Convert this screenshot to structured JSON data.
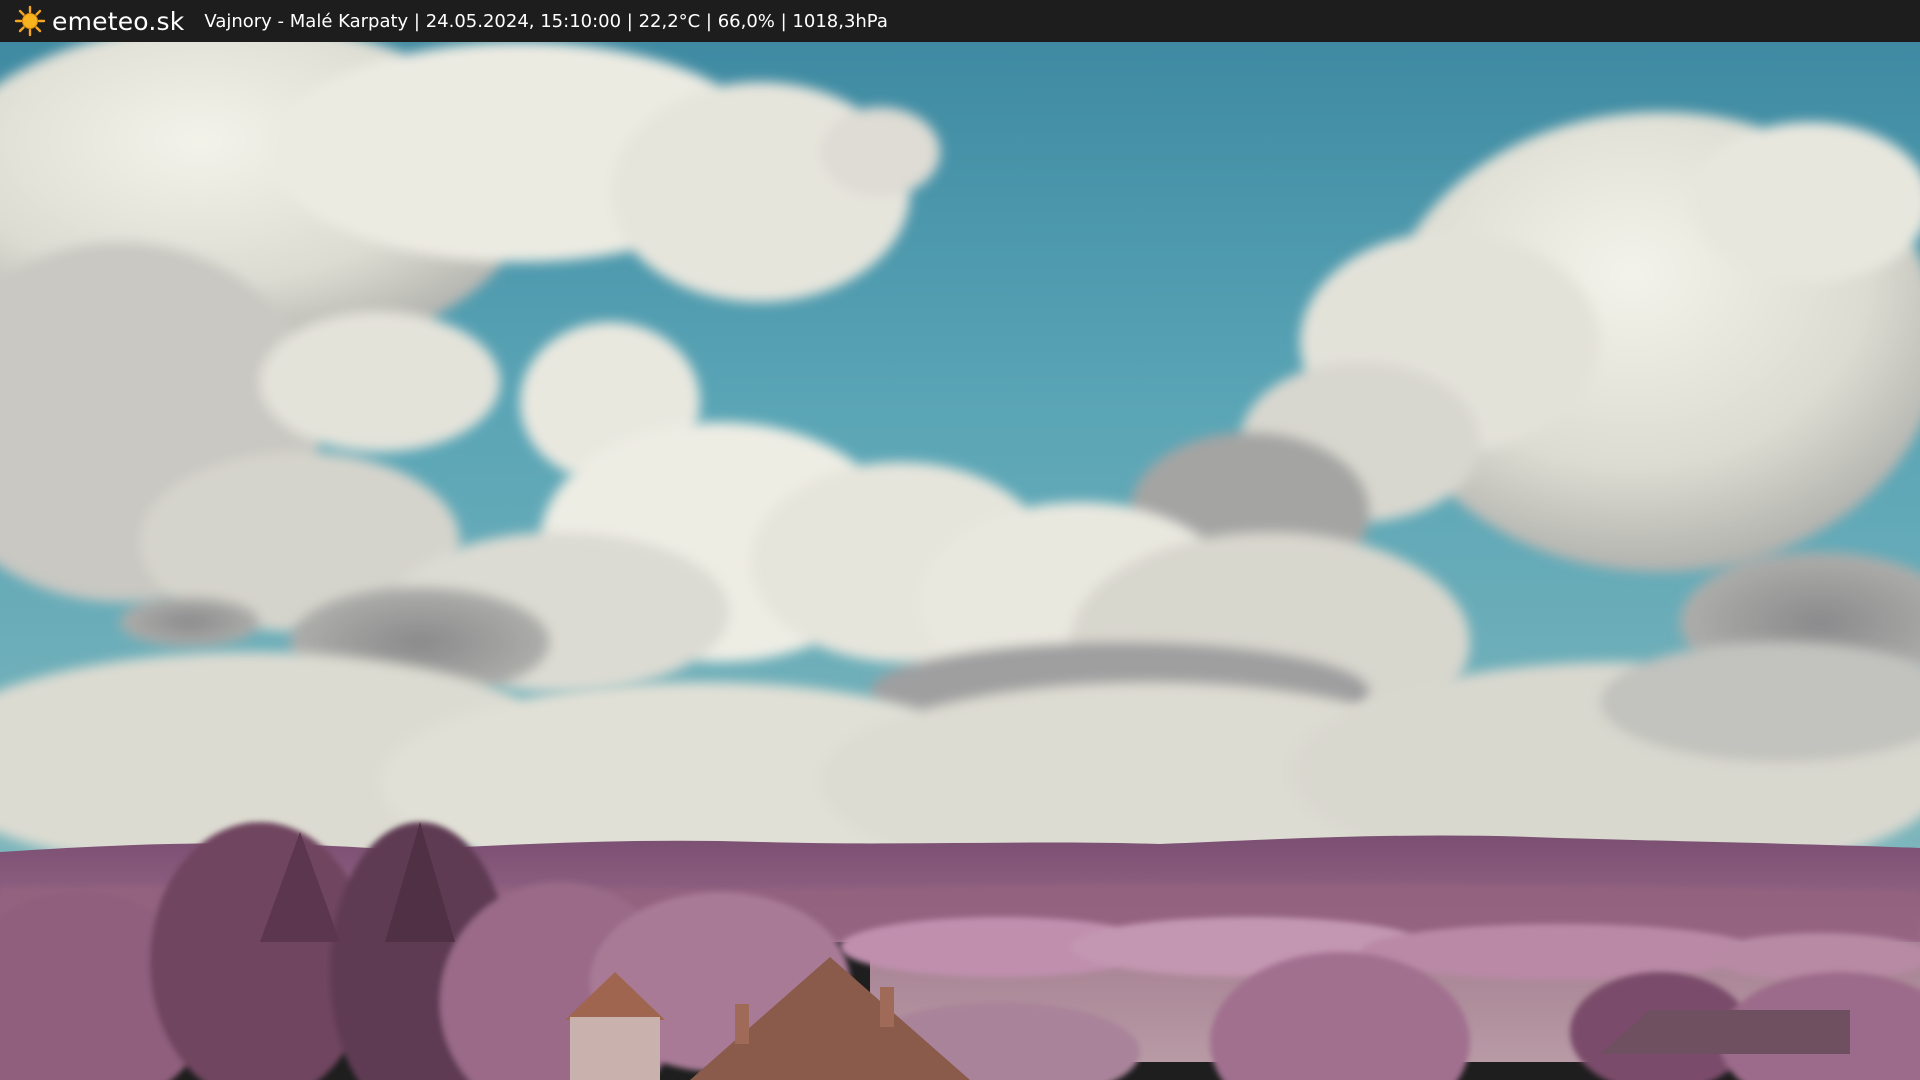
{
  "header": {
    "logo_text": "emeteo.sk",
    "caption": "Vajnory - Malé Karpaty | 24.05.2024, 15:10:00 | 22,2°C | 66,0% | 1018,3hPa",
    "logo_icon": "sun-icon"
  },
  "colors": {
    "bar": "#1d1d1d",
    "sun": "#f5a623",
    "sky": "#4d9cb0",
    "cloud": "#e8e8e0",
    "hills": "#8d5f80",
    "foliage": "#a3768f"
  }
}
